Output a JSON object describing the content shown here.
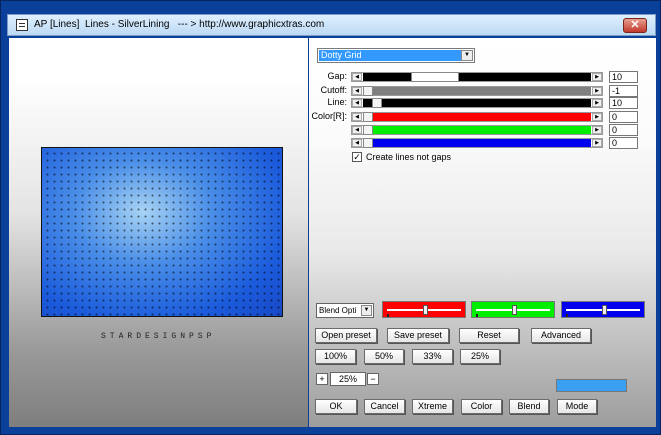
{
  "window": {
    "title": "AP [Lines]  Lines - SilverLining   --- > http://www.graphicxtras.com",
    "close_label": "✕"
  },
  "preview": {
    "watermark": "STARDESIGNPSP"
  },
  "preset": {
    "selected": "Dotty Grid"
  },
  "sliders": [
    {
      "label": "Gap:",
      "value": "10",
      "fraction": 0.22,
      "fill_color": "#000000"
    },
    {
      "label": "Cutoff:",
      "value": "-1",
      "fraction": 0.0,
      "fill_color": "#808080"
    },
    {
      "label": "Line:",
      "value": "10",
      "fraction": 0.04,
      "fill_color": "#000000"
    },
    {
      "label": "Color[R]:",
      "value": "0",
      "fraction": 0.0,
      "fill_color": "#ff0000"
    },
    {
      "label": "",
      "value": "0",
      "fraction": 0.0,
      "fill_color": "#00ee00"
    },
    {
      "label": "",
      "value": "0",
      "fraction": 0.0,
      "fill_color": "#0000ee"
    }
  ],
  "checkbox": {
    "label": "Create lines not gaps",
    "checked": true,
    "mark": "✓"
  },
  "blend": {
    "selected": "Blend Opti"
  },
  "color_sliders": [
    {
      "color": "#ff0000",
      "fraction": 0.5
    },
    {
      "color": "#00ee00",
      "fraction": 0.5
    },
    {
      "color": "#0000ee",
      "fraction": 0.5
    }
  ],
  "buttons": {
    "open_preset": "Open preset",
    "save_preset": "Save preset",
    "reset": "Reset",
    "advanced": "Advanced",
    "zoom_100": "100%",
    "zoom_50": "50%",
    "zoom_33": "33%",
    "zoom_25": "25%",
    "ok": "OK",
    "cancel": "Cancel",
    "xtreme": "Xtreme",
    "color": "Color",
    "blend": "Blend",
    "mode": "Mode"
  },
  "zoom": {
    "plus": "+",
    "minus": "−",
    "value": "25%"
  },
  "swatch_color": "#3a9ff0"
}
